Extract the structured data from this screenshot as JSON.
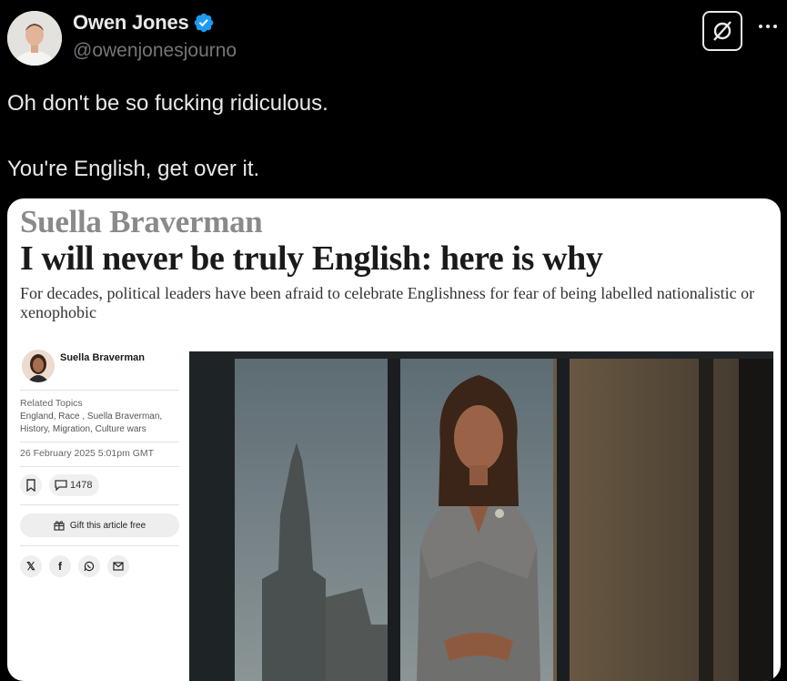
{
  "tweet": {
    "author_name": "Owen Jones",
    "handle": "@owenjonesjourno",
    "lines": [
      "Oh don't be so fucking ridiculous.",
      "You're English, get over it."
    ]
  },
  "article": {
    "author": "Suella Braverman",
    "title": "I will never be truly English: here is why",
    "standfirst": "For decades, political leaders have been afraid to celebrate Englishness for fear of being labelled nationalistic or xenophobic",
    "byline_name": "Suella Braverman",
    "related_label": "Related Topics",
    "related_topics": "England, Race , Suella Braverman, History, Migration, Culture wars",
    "date": "26 February 2025 5:01pm GMT",
    "comment_count": "1478",
    "gift_label": "Gift this article free"
  },
  "colors": {
    "background": "#000000",
    "text": "#e7e9ea",
    "muted": "#71767b",
    "verified": "#1d9bf0"
  },
  "icons": {
    "verified": "verified-badge-icon",
    "grok": "grok-icon",
    "more": "more-icon",
    "bookmark": "bookmark-icon",
    "comment": "comment-icon",
    "gift": "gift-icon",
    "x": "x-share-icon",
    "facebook": "facebook-icon",
    "whatsapp": "whatsapp-icon",
    "email": "email-icon"
  }
}
